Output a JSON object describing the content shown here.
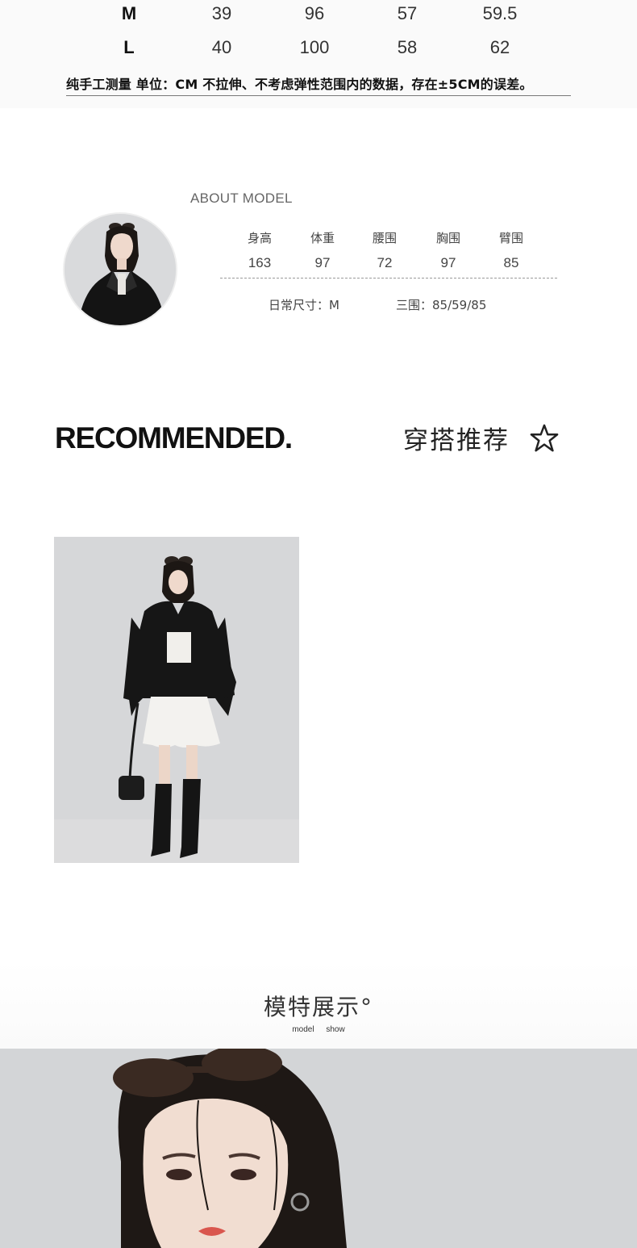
{
  "size_table": {
    "rows": [
      {
        "size": "M",
        "v1": "39",
        "v2": "96",
        "v3": "57",
        "v4": "59.5"
      },
      {
        "size": "L",
        "v1": "40",
        "v2": "100",
        "v3": "58",
        "v4": "62"
      }
    ],
    "note": "纯手工测量 单位：CM  不拉伸、不考虑弹性范围内的数据，存在±5CM的误差。"
  },
  "about_model": {
    "title": "ABOUT MODEL",
    "stat_labels": [
      "身高",
      "体重",
      "腰围",
      "胸围",
      "臂围"
    ],
    "stat_values": [
      "163",
      "97",
      "72",
      "97",
      "85"
    ],
    "daily_size": "日常尺寸：M",
    "measurements": "三围：85/59/85"
  },
  "recommended": {
    "title": "RECOMMENDED.",
    "title_cn": "穿搭推荐",
    "star_icon": "star-outline-icon"
  },
  "model_show": {
    "title": "模特展示°",
    "subtitle": "model show"
  }
}
